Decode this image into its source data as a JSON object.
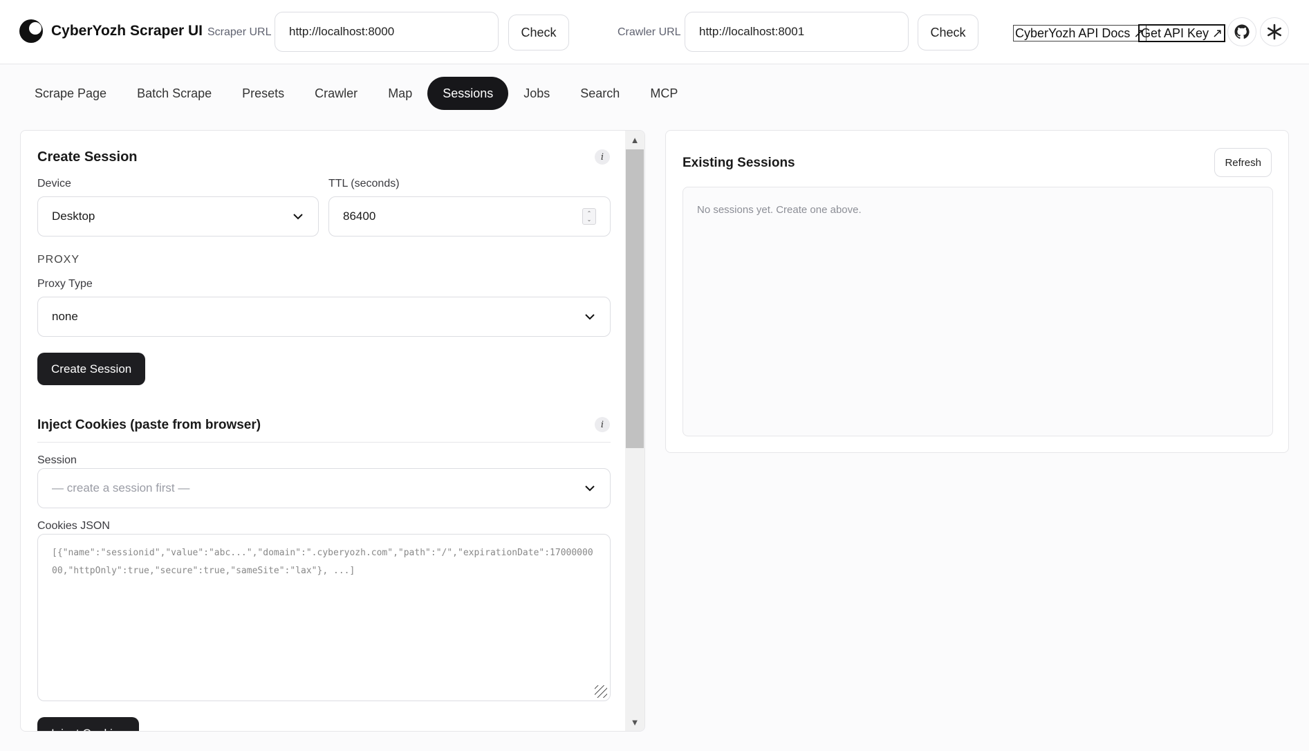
{
  "header": {
    "brand_title": "CyberYozh Scraper UI",
    "scraper_url_label": "Scraper URL",
    "scraper_url_value": "http://localhost:8000",
    "crawler_url_label": "Crawler URL",
    "crawler_url_value": "http://localhost:8001",
    "check_label": "Check",
    "api_docs_label": "CyberYozh API Docs ↗",
    "api_key_label": "Get API Key ↗",
    "icons": [
      "github-icon",
      "asterisk-icon"
    ]
  },
  "tabs": [
    {
      "label": "Scrape Page",
      "active": false
    },
    {
      "label": "Batch Scrape",
      "active": false
    },
    {
      "label": "Presets",
      "active": false
    },
    {
      "label": "Crawler",
      "active": false
    },
    {
      "label": "Map",
      "active": false
    },
    {
      "label": "Sessions",
      "active": true
    },
    {
      "label": "Jobs",
      "active": false
    },
    {
      "label": "Search",
      "active": false
    },
    {
      "label": "MCP",
      "active": false
    }
  ],
  "create_session": {
    "title": "Create Session",
    "info": "i",
    "device_label": "Device",
    "device_value": "Desktop",
    "ttl_label": "TTL (seconds)",
    "ttl_value": "86400",
    "proxy_section": "PROXY",
    "proxy_type_label": "Proxy Type",
    "proxy_type_value": "none",
    "submit_label": "Create Session"
  },
  "inject_cookies": {
    "title": "Inject Cookies (paste from browser)",
    "info": "i",
    "session_label": "Session",
    "session_placeholder": "— create a session first —",
    "cookies_label": "Cookies JSON",
    "cookies_placeholder": "[{\"name\":\"sessionid\",\"value\":\"abc...\",\"domain\":\".cyberyozh.com\",\"path\":\"/\",\"expirationDate\":1700000000,\"httpOnly\":true,\"secure\":true,\"sameSite\":\"lax\"}, ...]",
    "submit_label": "Inject Cookies"
  },
  "existing_sessions": {
    "title": "Existing Sessions",
    "refresh_label": "Refresh",
    "empty_message": "No sessions yet. Create one above."
  }
}
